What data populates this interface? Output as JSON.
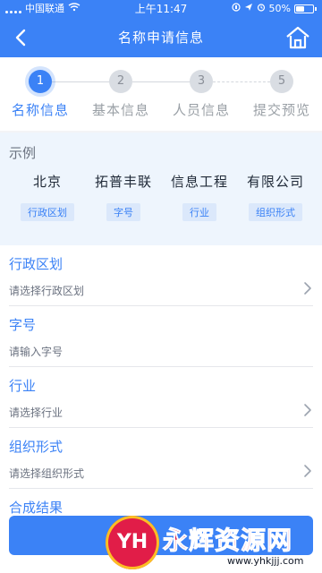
{
  "status_bar": {
    "carrier": "中国联通",
    "time": "上午11:47",
    "battery_percent": "50%"
  },
  "nav": {
    "title": "名称申请信息",
    "back_icon": "chevron-left-icon",
    "home_icon": "home-icon"
  },
  "stepper": {
    "steps": [
      {
        "num": "1",
        "label": "名称信息",
        "active": true
      },
      {
        "num": "2",
        "label": "基本信息",
        "active": false
      },
      {
        "num": "3",
        "label": "人员信息",
        "active": false
      },
      {
        "num": "5",
        "label": "提交预览",
        "active": false
      }
    ]
  },
  "example": {
    "title": "示例",
    "columns": [
      {
        "word": "北京",
        "tag": "行政区划"
      },
      {
        "word": "拓普丰联",
        "tag": "字号"
      },
      {
        "word": "信息工程",
        "tag": "行业"
      },
      {
        "word": "有限公司",
        "tag": "组织形式"
      }
    ]
  },
  "form": {
    "fields": [
      {
        "label": "行政区划",
        "value": "请选择行政区划",
        "has_chevron": true
      },
      {
        "label": "字号",
        "value": "请输入字号",
        "has_chevron": false
      },
      {
        "label": "行业",
        "value": "请选择行业",
        "has_chevron": true
      },
      {
        "label": "组织形式",
        "value": "请选择组织形式",
        "has_chevron": true
      },
      {
        "label": "合成结果",
        "value": "",
        "has_chevron": false
      }
    ]
  },
  "watermark": {
    "logo_text": "YH",
    "brand_text": "永辉资源网",
    "url": "www.yhkjjj.com"
  },
  "colors": {
    "primary": "#3b82f6",
    "background": "#f3f4f6",
    "example_bg": "#eef5fd",
    "watermark": "#e11d48"
  }
}
